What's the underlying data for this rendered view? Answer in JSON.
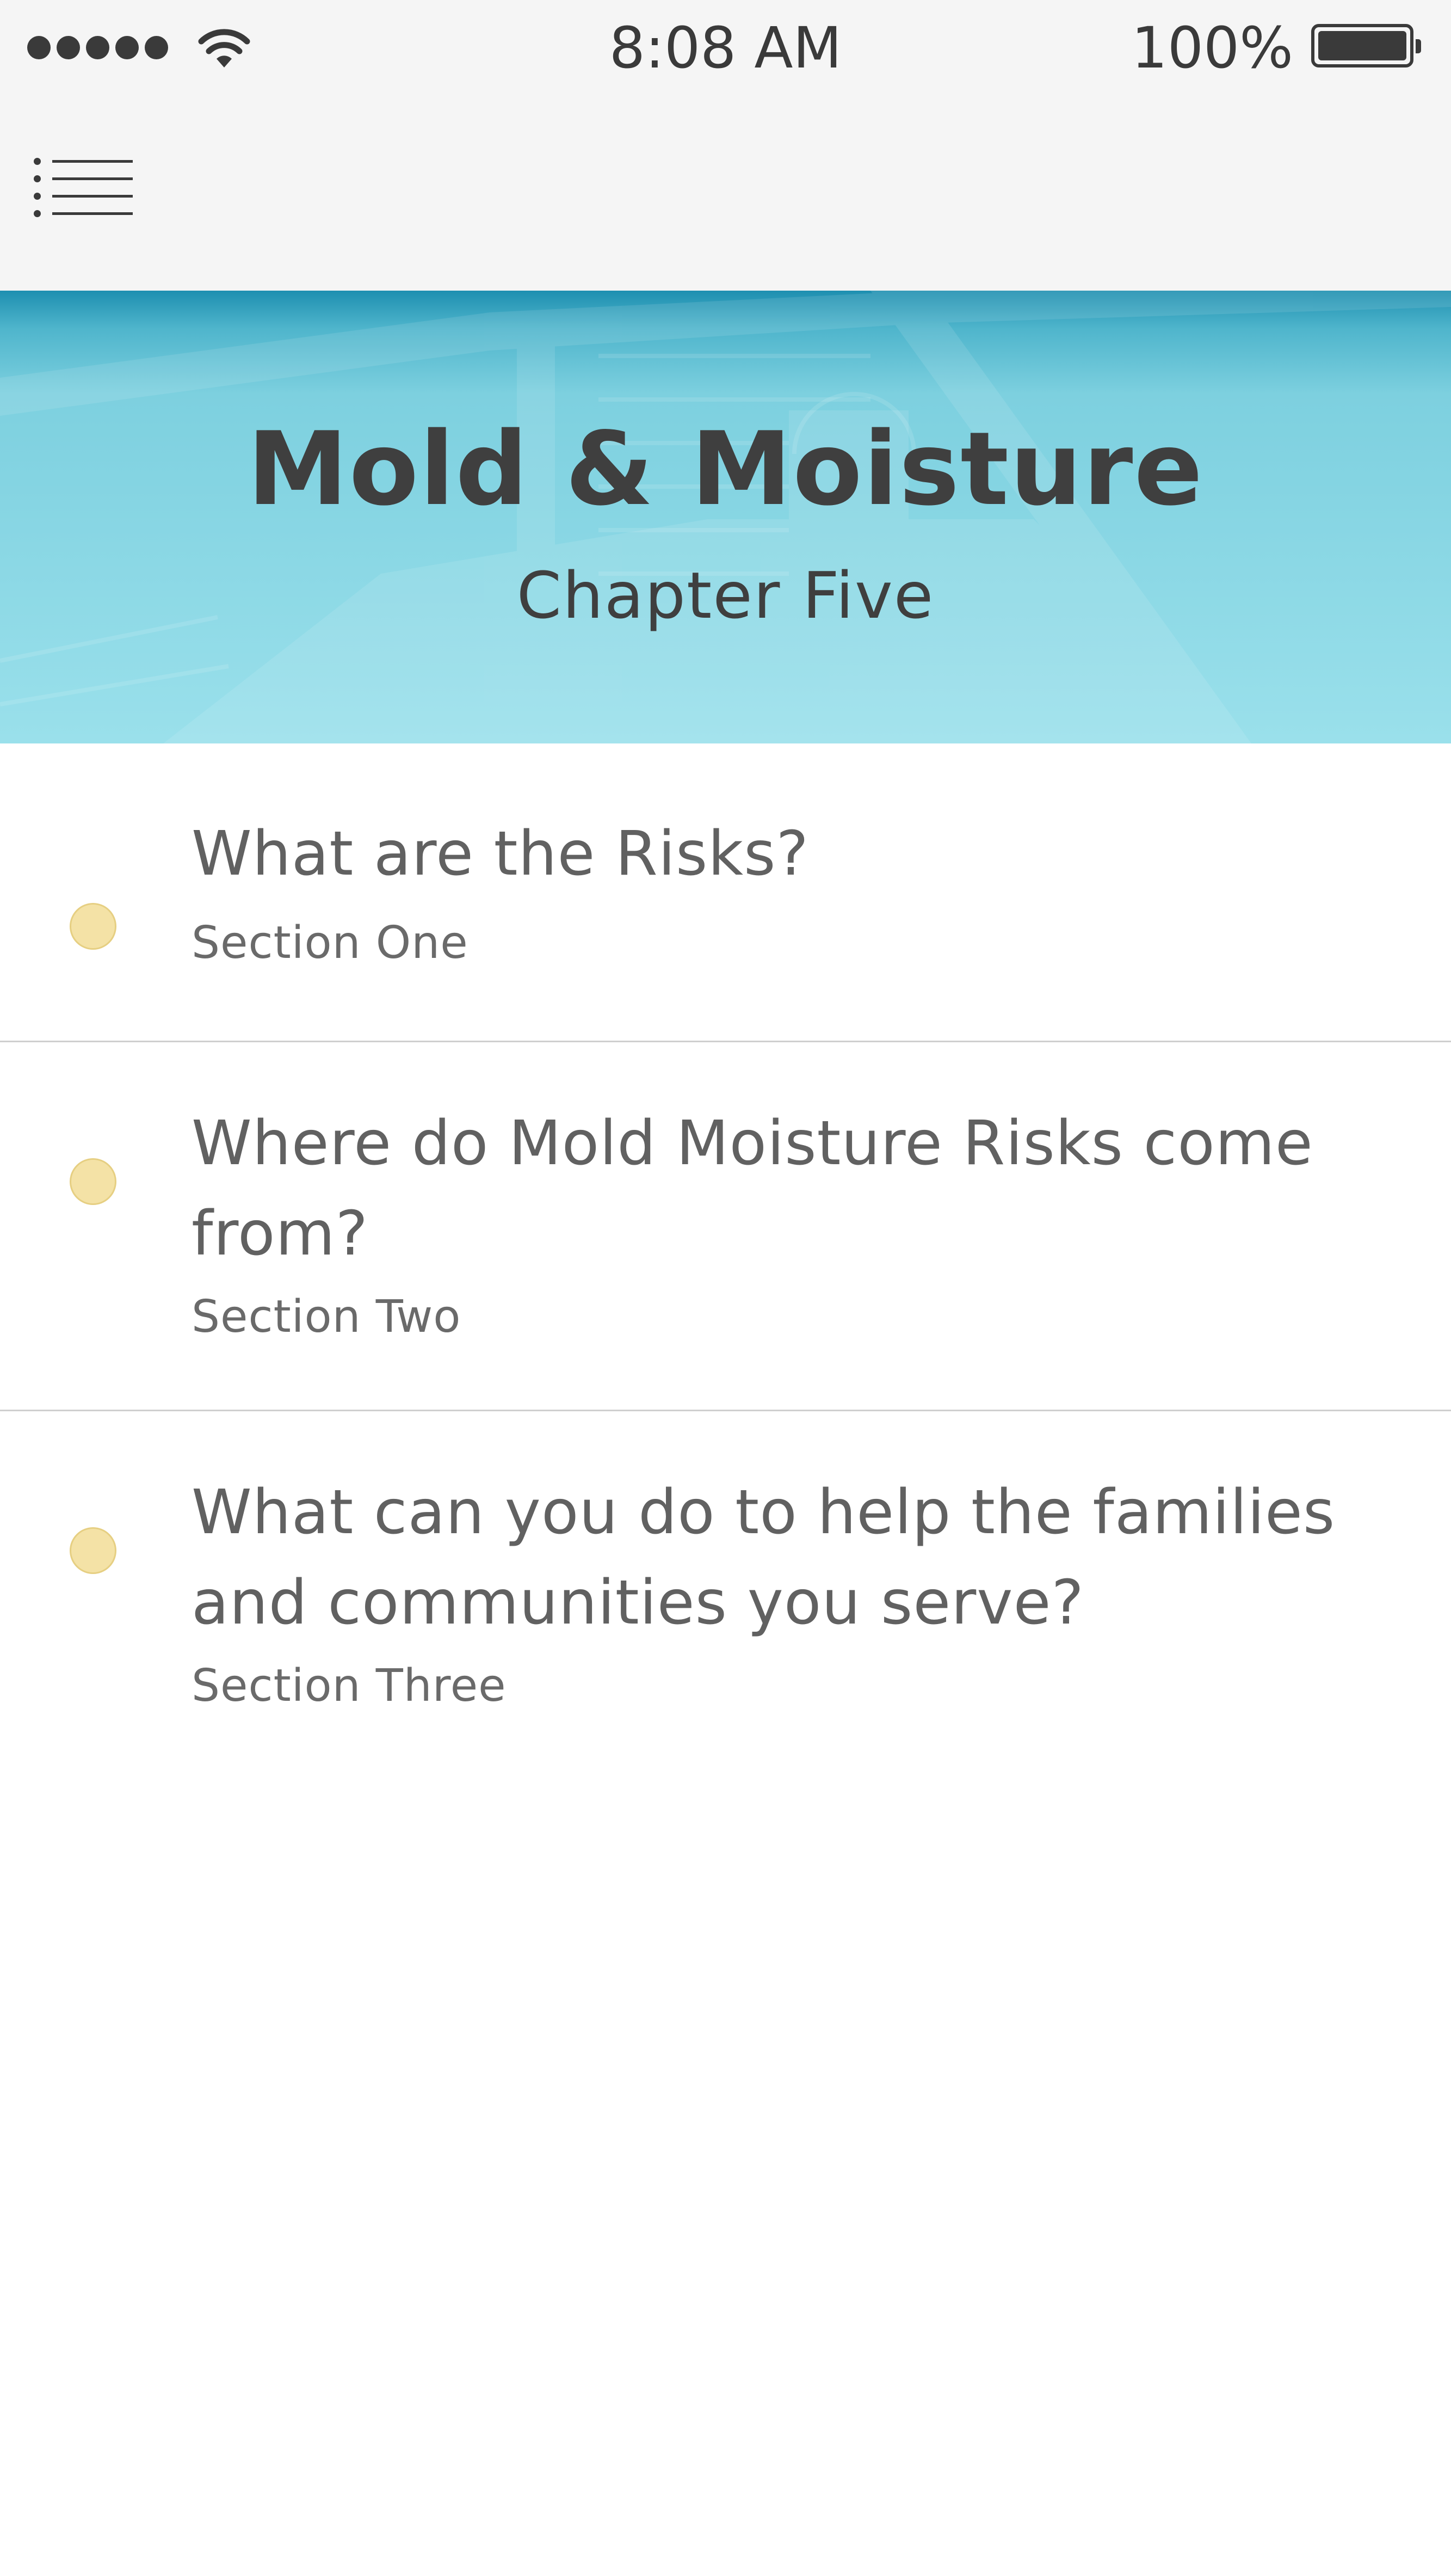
{
  "status_bar": {
    "time": "8:08 AM",
    "battery_percent": "100%",
    "signal_bars": 5,
    "icons": [
      "signal-dots-icon",
      "wifi-icon",
      "battery-icon"
    ]
  },
  "nav": {
    "menu_icon": "menu-list-icon"
  },
  "banner": {
    "title": "Mold & Moisture",
    "subtitle": "Chapter Five",
    "colors": {
      "top": "#1e8fb0",
      "bottom": "#9ae0eb"
    }
  },
  "sections": [
    {
      "title": "What are the Risks?",
      "subtitle": "Section One"
    },
    {
      "title": "Where do Mold Moisture Risks come from?",
      "subtitle": "Section Two"
    },
    {
      "title": "What can you do to help the families and communities you serve?",
      "subtitle": "Section Three"
    }
  ],
  "colors": {
    "bullet": "#f4e2a6",
    "text": "#616161",
    "divider": "#cfcfcf"
  }
}
